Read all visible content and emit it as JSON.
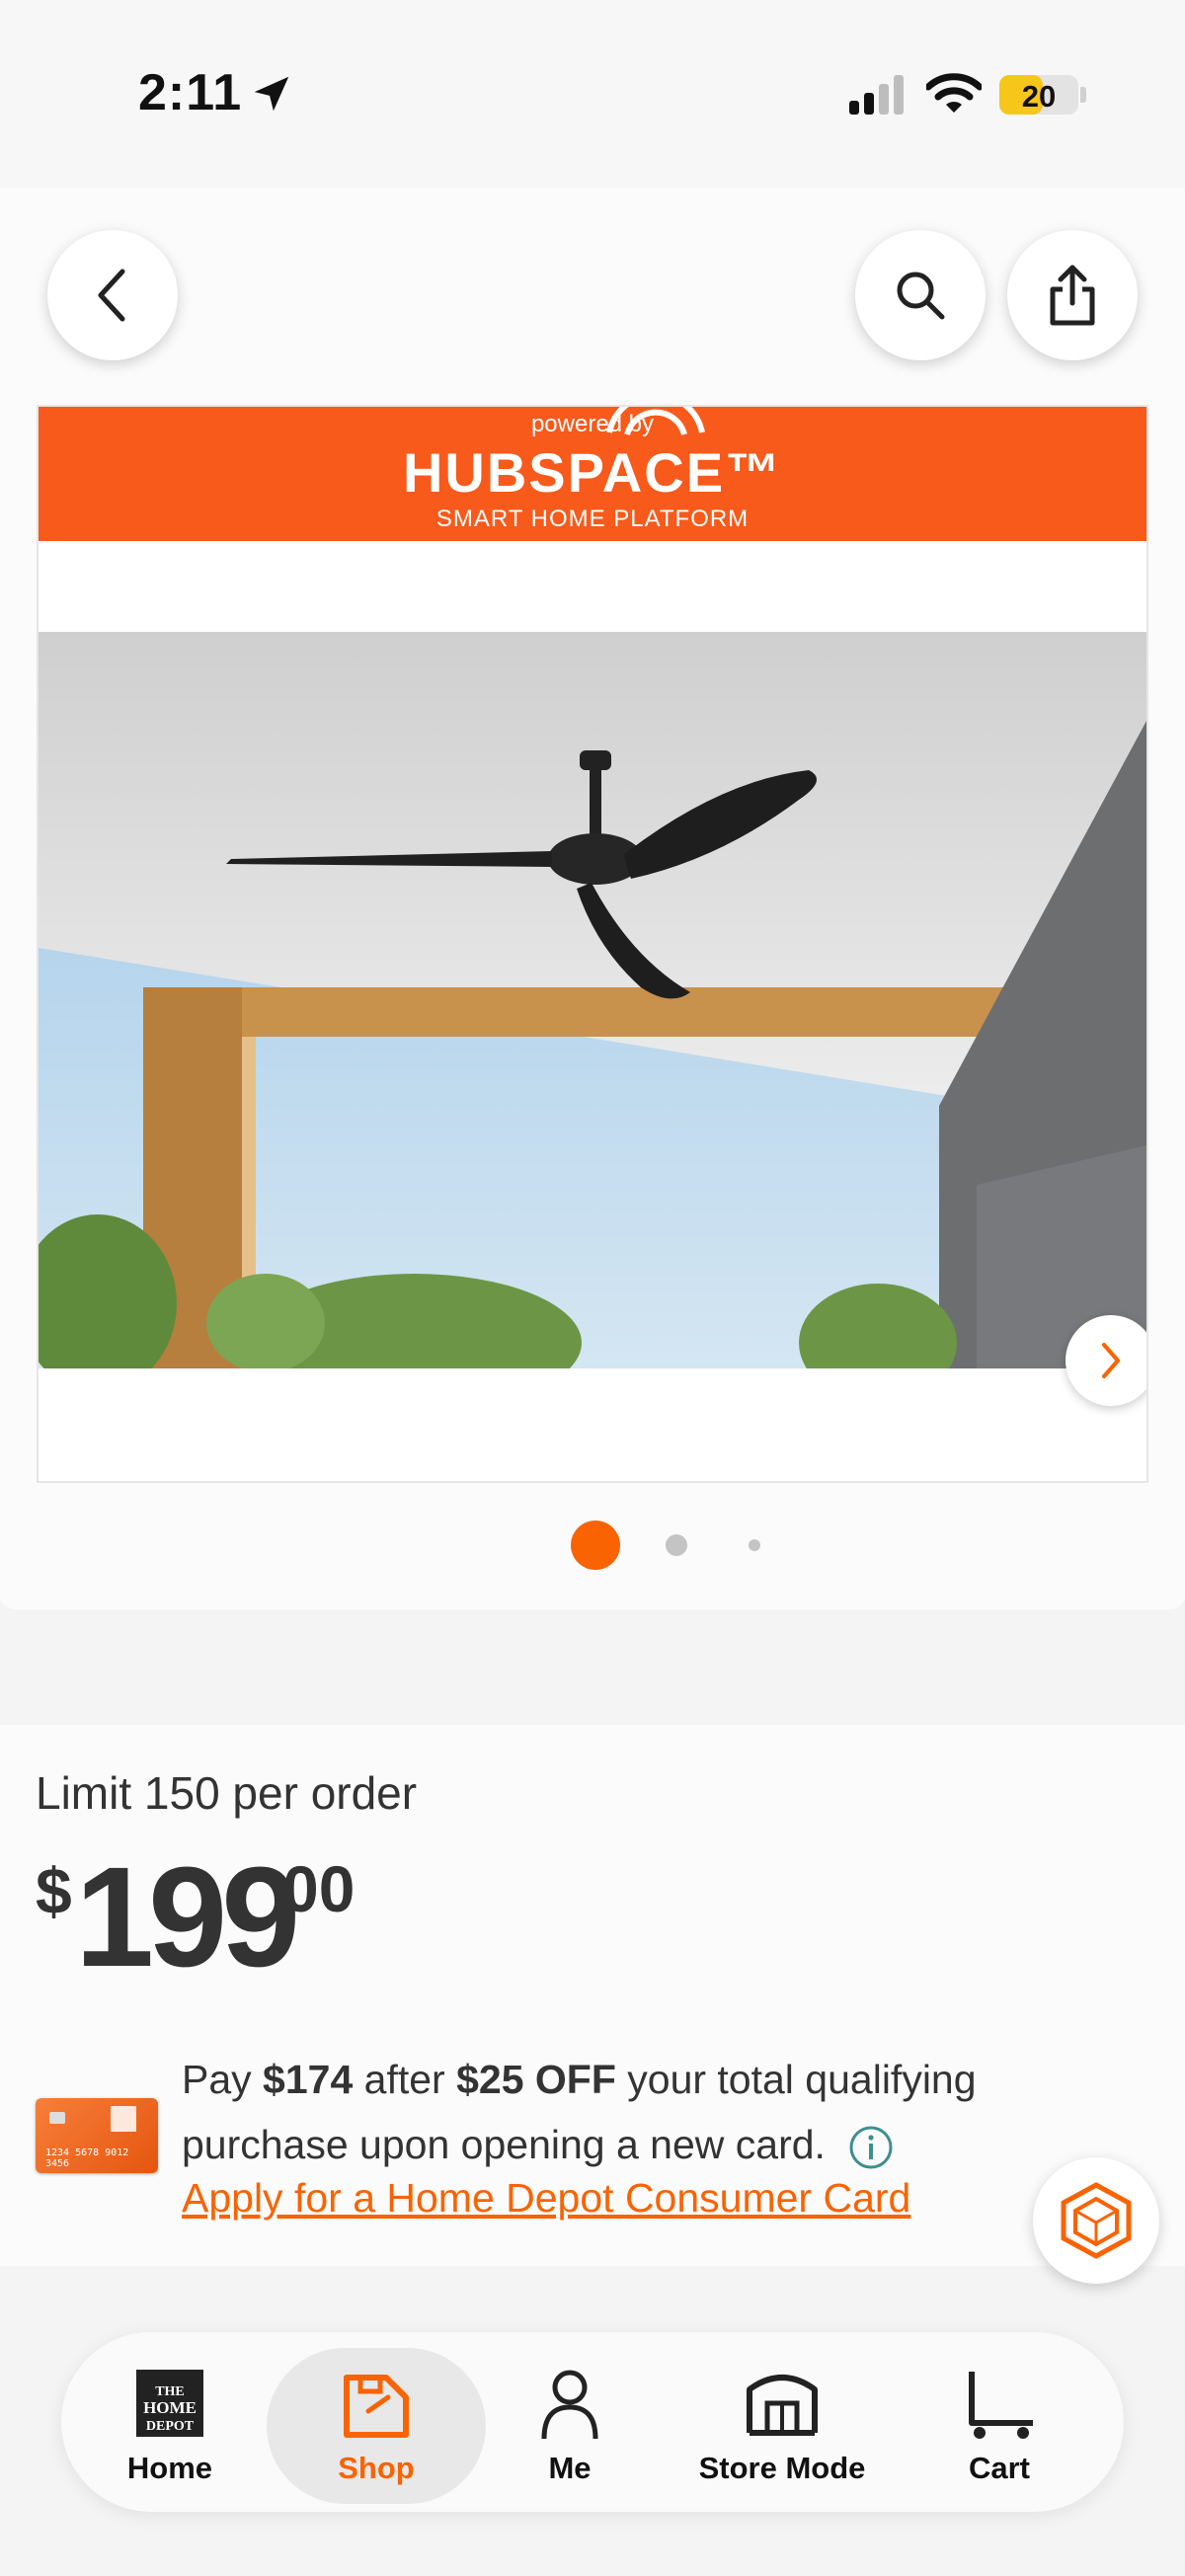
{
  "status_bar": {
    "time": "2:11",
    "battery": "20",
    "battery_level": 0.2,
    "battery_color": "#f6c61b"
  },
  "header": {
    "back_icon": "chevron-left-icon",
    "search_icon": "search-icon",
    "share_icon": "share-icon"
  },
  "media": {
    "banner_powered": "powered by",
    "banner_logo": "HUBSPACE™",
    "banner_sub": "SMART HOME PLATFORM",
    "image_description_icon": "ceiling-fan-photo",
    "next_icon": "chevron-right-icon",
    "carousel": {
      "count": 3,
      "active": 0
    }
  },
  "product": {
    "limit": "Limit 150 per order",
    "price_currency": "$",
    "price_whole": "199",
    "price_cents": "00"
  },
  "offer": {
    "card_number": "1234 5678 9012 3456",
    "text_pre": "Pay ",
    "amount_after": "$174",
    "text_mid": " after ",
    "discount": "$25 OFF",
    "text_post": " your total qualifying purchase upon opening a new card.",
    "apply_link": "Apply for a Home Depot Consumer Card"
  },
  "tabs": [
    {
      "label": "Home",
      "icon": "home-depot-logo-icon"
    },
    {
      "label": "Shop",
      "icon": "shop-bag-icon",
      "active": true
    },
    {
      "label": "Me",
      "icon": "person-icon"
    },
    {
      "label": "Store Mode",
      "icon": "store-icon"
    },
    {
      "label": "Cart",
      "icon": "cart-icon"
    }
  ],
  "colors": {
    "brand_orange": "#f96302",
    "banner_orange": "#f75a1b",
    "text_dark": "#333333"
  }
}
